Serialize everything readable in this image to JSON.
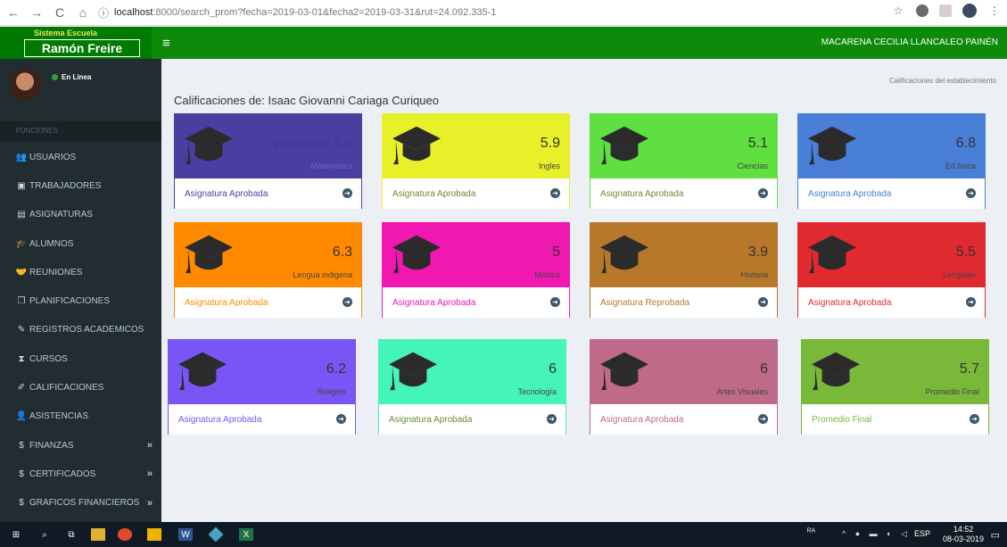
{
  "browser": {
    "url_host": "localhost",
    "url_path": ":8000/search_prom?fecha=2019-03-01&fecha2=2019-03-31&rut=24.092.335-1"
  },
  "header": {
    "logo_small": "Sistema Escuela",
    "logo_main": "Ramón Freire",
    "user": "MACARENA CECILIA LLANCALEO PAINÉN"
  },
  "sidebar": {
    "status": "En Linea",
    "section": "FUNCIONES",
    "items": [
      {
        "label": "USUARIOS",
        "icon": "users-icon"
      },
      {
        "label": "TRABAJADORES",
        "icon": "id-card-icon"
      },
      {
        "label": "ASIGNATURAS",
        "icon": "list-alt-icon"
      },
      {
        "label": "ALUMNOS",
        "icon": "graduation-cap-icon"
      },
      {
        "label": "REUNIONES",
        "icon": "handshake-icon"
      },
      {
        "label": "PLANIFICACIONES",
        "icon": "copy-icon"
      },
      {
        "label": "REGISTROS ACADEMICOS",
        "icon": "pencil-icon"
      },
      {
        "label": "CURSOS",
        "icon": "hourglass-icon"
      },
      {
        "label": "CALIFICACIONES",
        "icon": "edit-icon"
      },
      {
        "label": "ASISTENCIAS",
        "icon": "user-check-icon"
      },
      {
        "label": "FINANZAS",
        "icon": "dollar-icon",
        "chevron": "»"
      },
      {
        "label": "CERTIFICADOS",
        "icon": "dollar-icon",
        "chevron": "»"
      },
      {
        "label": "GRAFICOS FINANCIEROS",
        "icon": "dollar-icon",
        "chevron": "»"
      }
    ]
  },
  "content": {
    "title": "Calificaciones de: Isaac Giovanni Cariaga Curiqueo",
    "breadcrumb": "Calificaciones del establecimiento"
  },
  "cards": [
    {
      "value": "promedio:5.9",
      "subject": "Matematica",
      "footer": "Asignatura Aprobada",
      "color": "#4a3fa0"
    },
    {
      "value": "5.9",
      "subject": "Ingles",
      "footer": "Asignatura Aprobada",
      "color": "#e8f02a"
    },
    {
      "value": "5.1",
      "subject": "Ciencias",
      "footer": "Asignatura Aprobada",
      "color": "#5fe040"
    },
    {
      "value": "6.8",
      "subject": "Ed.fisica",
      "footer": "Asignatura Aprobada",
      "color": "#4a7fd8"
    },
    {
      "value": "6.3",
      "subject": "Lengua indigena",
      "footer": "Asignatura Aprobada",
      "color": "#ff8a00"
    },
    {
      "value": "5",
      "subject": "Música",
      "footer": "Asignatura Aprobada",
      "color": "#f018b0"
    },
    {
      "value": "3.9",
      "subject": "Historia",
      "footer": "Asignatura Reprobada",
      "color": "#b8782a"
    },
    {
      "value": "5.5",
      "subject": "Lenguaje",
      "footer": "Asignatura Aprobada",
      "color": "#e02a30"
    },
    {
      "value": "6.2",
      "subject": "Religión",
      "footer": "Asignatura Aprobada",
      "color": "#7a55f5"
    },
    {
      "value": "6",
      "subject": "Tecnología",
      "footer": "Asignatura Aprobada",
      "color": "#45f5b8"
    },
    {
      "value": "6",
      "subject": "Artes Visuales",
      "footer": "Asignatura Aprobada",
      "color": "#c06a8a"
    },
    {
      "value": "5.7",
      "subject": "Promedio Final",
      "footer": "Promedio Final",
      "color": "#7ab83a"
    }
  ],
  "taskbar": {
    "lang": "ESP",
    "time": "14:52",
    "date": "08-03-2019"
  }
}
